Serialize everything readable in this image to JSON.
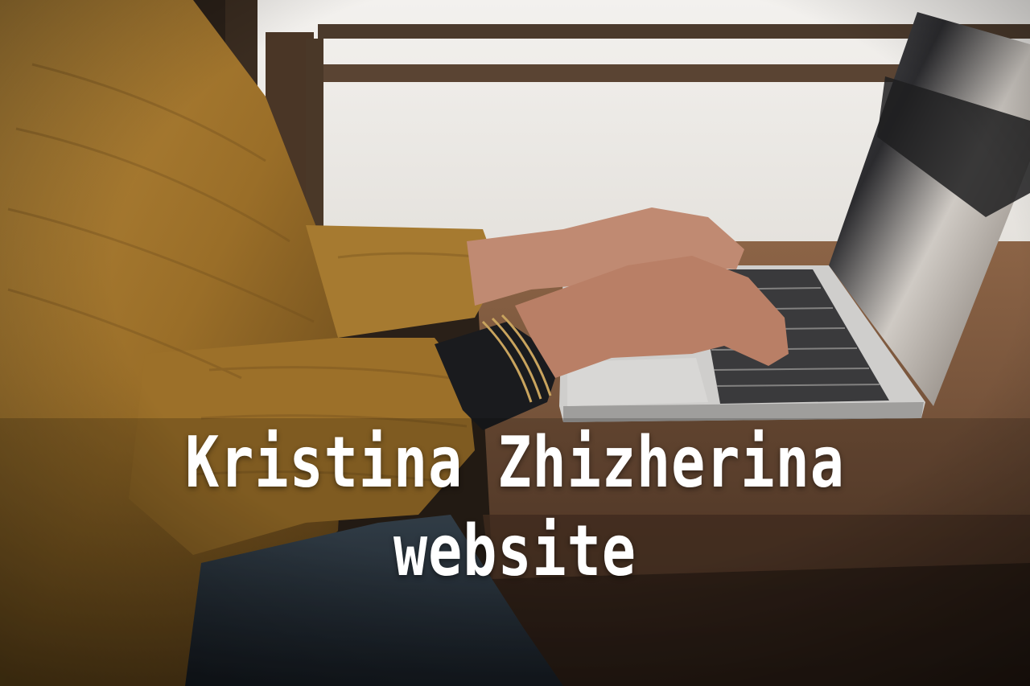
{
  "hero": {
    "title_line_1": "Kristina Zhizherina",
    "title_line_2": "website"
  },
  "colors": {
    "sweater": "#a87a2c",
    "window_light": "#f1efec",
    "desk": "#7a5338",
    "laptop_body": "#c9c8c6",
    "text": "#ffffff"
  }
}
